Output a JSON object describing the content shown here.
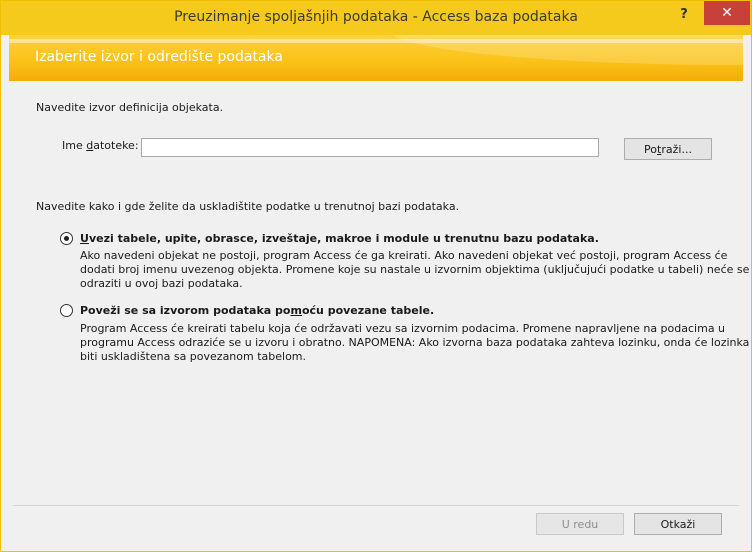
{
  "window": {
    "title": "Preuzimanje spoljašnjih podataka - Access baza podataka",
    "help_label": "?",
    "close_label": "✕"
  },
  "banner": {
    "text": "Izaberite izvor i odredište podataka"
  },
  "source": {
    "instruction": "Navedite izvor definicija objekata.",
    "file_label_pre": "Ime ",
    "file_label_mnemonic": "d",
    "file_label_post": "atoteke:",
    "file_value": "",
    "browse_pre": "Po",
    "browse_mnemonic": "t",
    "browse_post": "raži..."
  },
  "storage": {
    "instruction": "Navedite kako i gde želite da uskladištite podatke u trenutnoj bazi podataka.",
    "options": [
      {
        "label_mnemonic": "U",
        "label_rest": "vezi tabele, upite, obrasce, izveštaje, makroe i module u trenutnu bazu podataka.",
        "selected": true,
        "description": [
          "Ako navedeni objekat ne postoji, program Access će ga kreirati. Ako navedeni objekat već postoji, program Access će",
          "dodati broj imenu uvezenog objekta. Promene koje su nastale u izvornim objektima (uključujući podatke u tabeli) neće se",
          "odraziti u ovoj bazi podataka."
        ]
      },
      {
        "label_pre": "Poveži se sa izvorom podataka po",
        "label_mnemonic": "m",
        "label_post": "oću povezane tabele.",
        "selected": false,
        "description": [
          "Program Access će kreirati tabelu koja će održavati vezu sa izvornim podacima. Promene napravljene na podacima u",
          "programu Access odraziće se u izvoru i obratno. NAPOMENA: Ako izvorna baza podataka zahteva lozinku, onda će lozinka",
          "biti uskladištena sa povezanom tabelom."
        ]
      }
    ]
  },
  "footer": {
    "ok_label": "U redu",
    "cancel_label": "Otkaži"
  },
  "colors": {
    "accent": "#f6c91d",
    "close": "#c8403a",
    "banner_text": "#ffffff"
  }
}
